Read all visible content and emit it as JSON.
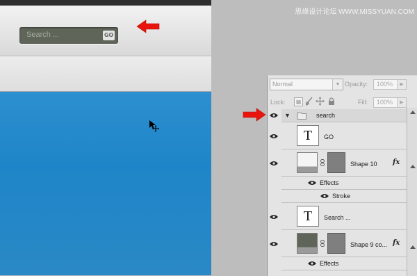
{
  "watermark": "思缘设计论坛 WWW.MISSYUAN.COM",
  "canvas": {
    "search_placeholder": "Search ...",
    "go_label": "GO"
  },
  "colors": {
    "blue": "#1e86c8",
    "search_box": "#5f6559",
    "arrow": "#e8150e"
  },
  "layers_panel": {
    "blend_mode": "Normal",
    "opacity_label": "Opacity:",
    "opacity_value": "100%",
    "lock_label": "Lock:",
    "fill_label": "Fill:",
    "fill_value": "100%",
    "group_name": "search",
    "layers": [
      {
        "name": "GO",
        "type": "text"
      },
      {
        "name": "Shape 10",
        "type": "shape",
        "fx": "fx",
        "effects_label": "Effects",
        "effect": "Stroke"
      },
      {
        "name": "Search ...",
        "type": "text"
      },
      {
        "name": "Shape 9 co...",
        "type": "shape",
        "fx": "fx",
        "effects_label": "Effects"
      }
    ],
    "text_thumb": "T",
    "icons": [
      "eye-icon",
      "folder-icon",
      "chain-icon",
      "fx-icon",
      "lock-transparent-icon",
      "lock-brush-icon",
      "lock-move-icon",
      "lock-all-icon"
    ]
  }
}
